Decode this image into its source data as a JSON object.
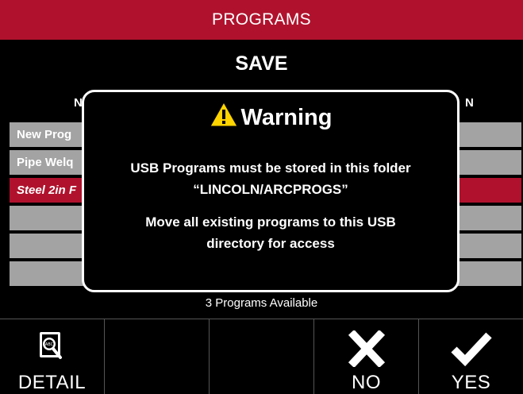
{
  "header": {
    "title": "PROGRAMS"
  },
  "screen": {
    "subtitle": "SAVE"
  },
  "columns": {
    "left_partial": "N",
    "right_partial": "N"
  },
  "programs": [
    {
      "name": "New Prog",
      "selected": false
    },
    {
      "name": "Pipe Welq",
      "selected": false
    },
    {
      "name": "Steel 2in F",
      "selected": true
    },
    {
      "name": "",
      "selected": false
    },
    {
      "name": "",
      "selected": false
    },
    {
      "name": "",
      "selected": false
    }
  ],
  "status": {
    "count_text": "3 Programs Available"
  },
  "softkeys": [
    {
      "label": "DETAIL",
      "icon": "detail-icon"
    },
    {
      "label": "",
      "icon": ""
    },
    {
      "label": "",
      "icon": ""
    },
    {
      "label": "NO",
      "icon": "x-icon"
    },
    {
      "label": "YES",
      "icon": "check-icon"
    }
  ],
  "dialog": {
    "title": "Warning",
    "icon": "warning-icon",
    "line1": "USB Programs must be stored in this folder",
    "line2": "“LINCOLN/ARCPROGS”",
    "line3": "Move all existing programs to this USB",
    "line4": "directory for access"
  },
  "colors": {
    "brand_red": "#b0122d",
    "row_gray": "#a3a3a3",
    "warning_yellow": "#ffd400",
    "background": "#000000"
  }
}
